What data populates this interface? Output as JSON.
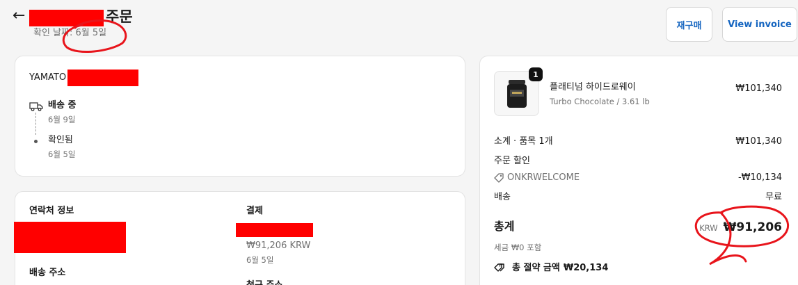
{
  "header": {
    "back_icon": "arrow-left-icon",
    "title_suffix": "주문",
    "confirmed_date": "확인 날짜: 6월 5일",
    "reorder_label": "재구매",
    "invoice_label": "View invoice"
  },
  "status_card": {
    "carrier": "YAMATO",
    "steps": [
      {
        "title": "배송 중",
        "date": "6월 9일",
        "icon": "delivery-truck-icon"
      },
      {
        "title": "확인됨",
        "date": "6월 5일",
        "icon": "dot-icon"
      }
    ]
  },
  "info_card": {
    "contact_heading": "연락처 정보",
    "shipping_heading": "배송 주소",
    "payment_heading": "결제",
    "payment_amount": "₩91,206 KRW",
    "payment_date": "6월 5일",
    "billing_heading": "청구 주소"
  },
  "summary": {
    "item": {
      "name": "플래티넘 하이드로웨이",
      "variant": "Turbo Chocolate / 3.61 lb",
      "price": "₩101,340",
      "quantity": "1"
    },
    "subtotal_label": "소계 · 품목 1개",
    "subtotal_value": "₩101,340",
    "discount_label": "주문 할인",
    "discount_code": "ONKRWELCOME",
    "discount_value": "-₩10,134",
    "shipping_label": "배송",
    "shipping_value": "무료",
    "total_label": "총계",
    "total_currency": "KRW",
    "total_value": "₩91,206",
    "tax_note": "세금 ₩0 포함",
    "savings_label": "총 절약 금액",
    "savings_value": "₩20,134"
  },
  "colors": {
    "accent": "#1565c0",
    "redaction": "#ff0000",
    "annotation": "#e8141b"
  }
}
